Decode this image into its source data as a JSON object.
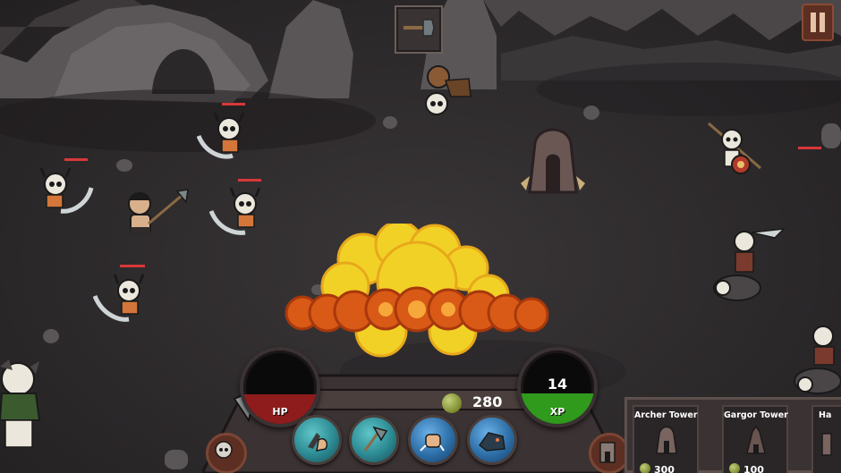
{
  "hud": {
    "hp_label": "HP",
    "xp_label": "XP",
    "level": "14",
    "hp_fill_fraction": 0.4,
    "xp_fill_fraction": 0.42,
    "gold": "280"
  },
  "top": {
    "equipped_weapon_icon": "axe-icon",
    "pause_icon": "pause-icon"
  },
  "skills": [
    {
      "icon": "hand-grab-skill-icon"
    },
    {
      "icon": "axe-strike-skill-icon"
    },
    {
      "icon": "fist-smash-skill-icon"
    },
    {
      "icon": "beast-charge-skill-icon"
    }
  ],
  "shop": {
    "items": [
      {
        "name": "Archer Tower",
        "price": "300"
      },
      {
        "name": "Gargor Tower",
        "price": "100"
      },
      {
        "name": "Ha",
        "price": ""
      }
    ]
  },
  "colors": {
    "hp": "#8e1c1c",
    "xp": "#2f9a1c",
    "enemy_health": "#d8383a",
    "explosion_core": "#f2d126",
    "explosion_ring": "#d85a16"
  }
}
